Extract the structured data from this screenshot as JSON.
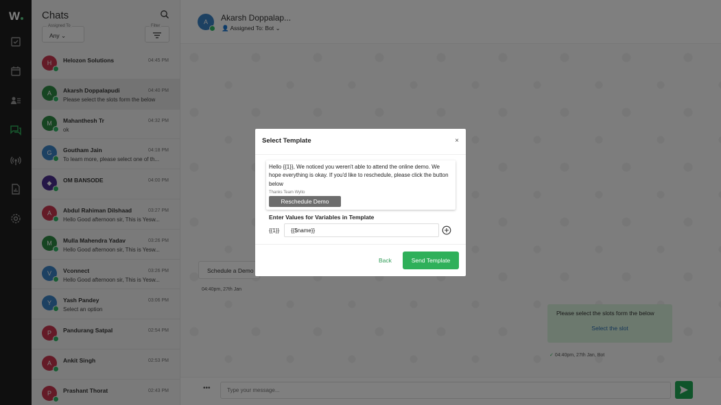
{
  "app": {
    "logo": "W"
  },
  "rail": {
    "icons": [
      "tasks-icon",
      "calendar-icon",
      "contacts-icon",
      "chats-icon",
      "broadcast-icon",
      "reports-icon",
      "settings-icon"
    ]
  },
  "panel": {
    "title": "Chats",
    "assigned_caption": "Assigned To",
    "assigned_value": "Any",
    "filter_caption": "Filter",
    "chats": [
      {
        "initial": "H",
        "color": "#c8364f",
        "name": "Helozon Solutions",
        "preview": "",
        "time": "04:45 PM"
      },
      {
        "initial": "A",
        "color": "#2e8b45",
        "name": "Akarsh Doppalapudi",
        "preview": "Please select the slots form the below",
        "time": "04:40 PM"
      },
      {
        "initial": "M",
        "color": "#2e8b45",
        "name": "Mahanthesh Tr",
        "preview": "ok",
        "time": "04:32 PM"
      },
      {
        "initial": "G",
        "color": "#3b82c4",
        "name": "Goutham Jain",
        "preview": "To learn more, please select one of th...",
        "time": "04:18 PM"
      },
      {
        "initial": "◆",
        "color": "#4b2f8f",
        "name": "OM BANSODE",
        "preview": "",
        "time": "04:00 PM"
      },
      {
        "initial": "A",
        "color": "#c8364f",
        "name": "Abdul Rahiman Dilshaad",
        "preview": "Hello Good afternoon sir, This is Yesw...",
        "time": "03:27 PM"
      },
      {
        "initial": "M",
        "color": "#2e8b45",
        "name": "Mulla Mahendra Yadav",
        "preview": "Hello Good afternoon sir, This is Yesw...",
        "time": "03:26 PM"
      },
      {
        "initial": "V",
        "color": "#3b82c4",
        "name": "Vconnect",
        "preview": "Hello Good afternoon sir, This is Yesw...",
        "time": "03:26 PM"
      },
      {
        "initial": "Y",
        "color": "#3b82c4",
        "name": "Yash Pandey",
        "preview": "Select an option",
        "time": "03:06 PM"
      },
      {
        "initial": "P",
        "color": "#c8364f",
        "name": "Pandurang Satpal",
        "preview": "",
        "time": "02:54 PM"
      },
      {
        "initial": "A",
        "color": "#c8364f",
        "name": "Ankit Singh",
        "preview": "",
        "time": "02:53 PM"
      },
      {
        "initial": "P",
        "color": "#c8364f",
        "name": "Prashant Thorat",
        "preview": "",
        "time": "02:43 PM"
      }
    ]
  },
  "conversation": {
    "avatar_initial": "A",
    "name": "Akarsh Doppalap...",
    "assigned_to": "Assigned To: Bot",
    "schedule_text": "Schedule a Demo",
    "schedule_time": "04:40pm, 27th Jan",
    "bubble_text": "Please select the slots form the below",
    "bubble_link": "Select the slot",
    "bubble_time": "04:40pm, 27th Jan, Bot",
    "composer_placeholder": "Type your message...",
    "more_label": "•••"
  },
  "modal": {
    "title": "Select Template",
    "close": "×",
    "template_body": "Hello {{1}}, We noticed you weren't able to attend the online demo. We hope everything is okay. If you'd like to reschedule, please click the button below",
    "template_footer": "Thanks Team Wylto",
    "template_button": "Reschedule Demo",
    "vars_title": "Enter Values for Variables in Template",
    "var_label": "{{1}}",
    "var_value": "{{$name}}",
    "back": "Back",
    "send": "Send Template"
  },
  "colors": {
    "accent": "#2fb05a",
    "rail": "#1e1e1e",
    "overlay": "rgba(0,0,0,0.5)"
  }
}
